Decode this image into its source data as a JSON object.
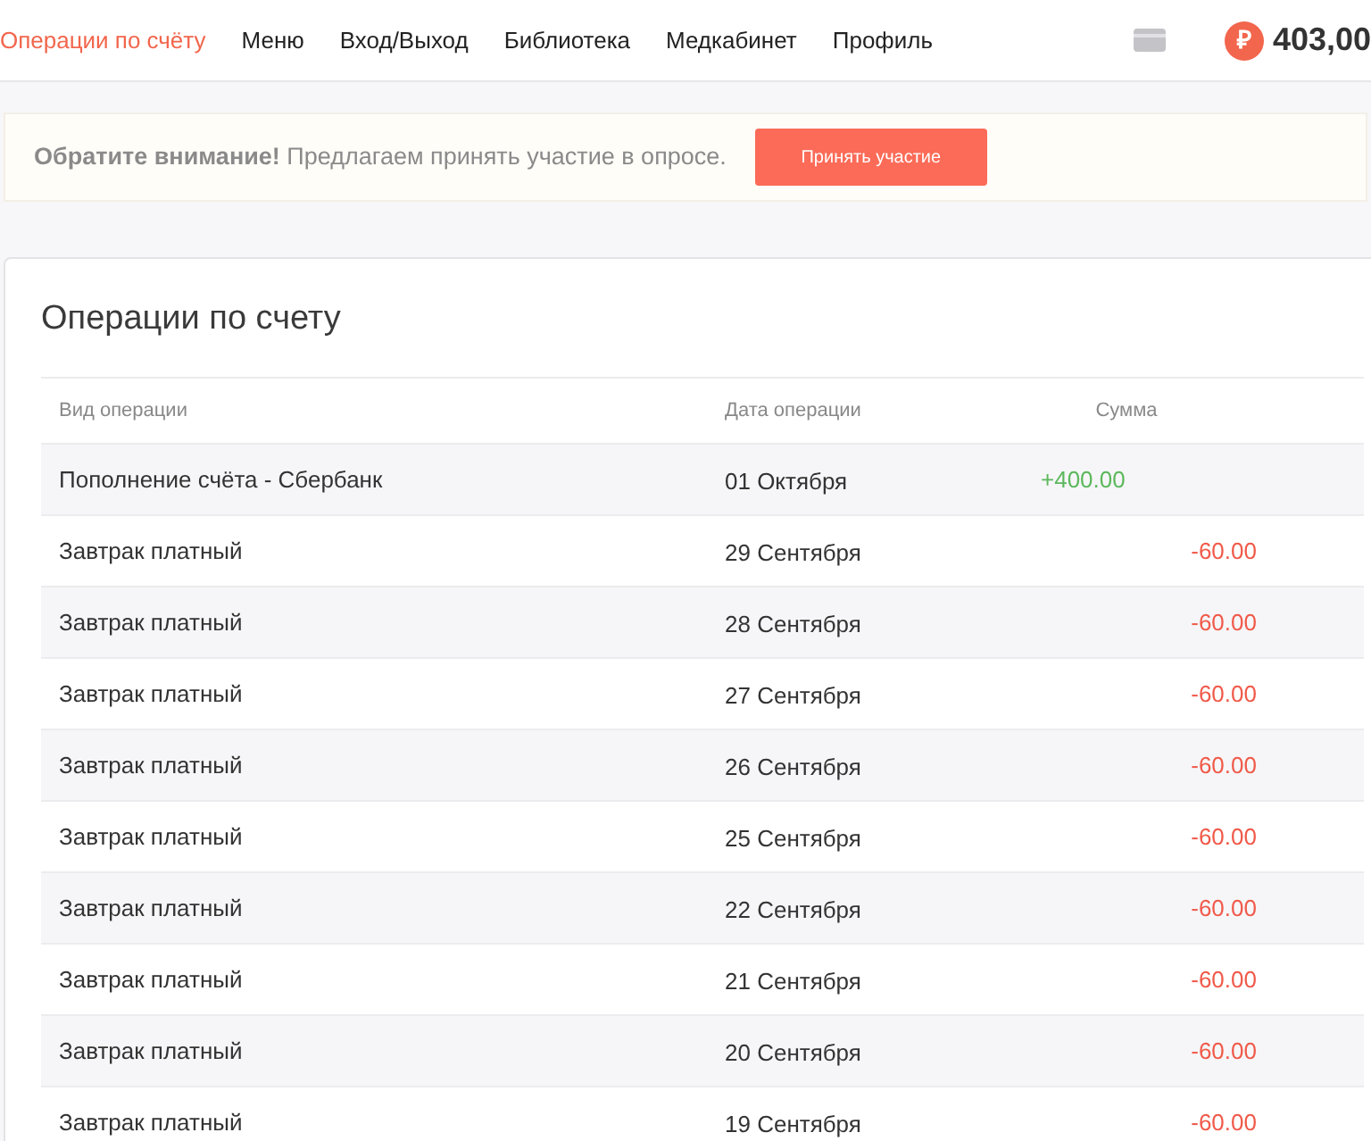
{
  "nav": {
    "items": [
      {
        "label": "Операции по счёту",
        "selected": true
      },
      {
        "label": "Меню",
        "selected": false
      },
      {
        "label": "Вход/Выход",
        "selected": false
      },
      {
        "label": "Библиотека",
        "selected": false
      },
      {
        "label": "Медкабинет",
        "selected": false
      },
      {
        "label": "Профиль",
        "selected": false
      }
    ],
    "currency_sign": "₽",
    "balance": "403,00"
  },
  "notice": {
    "text": "**Обратите внимание!** Предлагаем принять участие в опросе.",
    "button": "Принять участие"
  },
  "operations": {
    "title": "Операции по счету",
    "columns": [
      "Вид операции",
      "Дата операции",
      "Сумма"
    ],
    "rows": [
      {
        "type": "Пополнение счёта - Сбербанк",
        "date": "01 Октября",
        "amount": "+400.00",
        "kind": "credit"
      },
      {
        "type": "Завтрак платный",
        "date": "29 Сентября",
        "amount": "-60.00",
        "kind": "debit"
      },
      {
        "type": "Завтрак платный",
        "date": "28 Сентября",
        "amount": "-60.00",
        "kind": "debit"
      },
      {
        "type": "Завтрак платный",
        "date": "27 Сентября",
        "amount": "-60.00",
        "kind": "debit"
      },
      {
        "type": "Завтрак платный",
        "date": "26 Сентября",
        "amount": "-60.00",
        "kind": "debit"
      },
      {
        "type": "Завтрак платный",
        "date": "25 Сентября",
        "amount": "-60.00",
        "kind": "debit"
      },
      {
        "type": "Завтрак платный",
        "date": "22 Сентября",
        "amount": "-60.00",
        "kind": "debit"
      },
      {
        "type": "Завтрак платный",
        "date": "21 Сентября",
        "amount": "-60.00",
        "kind": "debit"
      },
      {
        "type": "Завтрак платный",
        "date": "20 Сентября",
        "amount": "-60.00",
        "kind": "debit"
      },
      {
        "type": "Завтрак платный",
        "date": "19 Сентября",
        "amount": "-60.00",
        "kind": "debit"
      }
    ]
  }
}
